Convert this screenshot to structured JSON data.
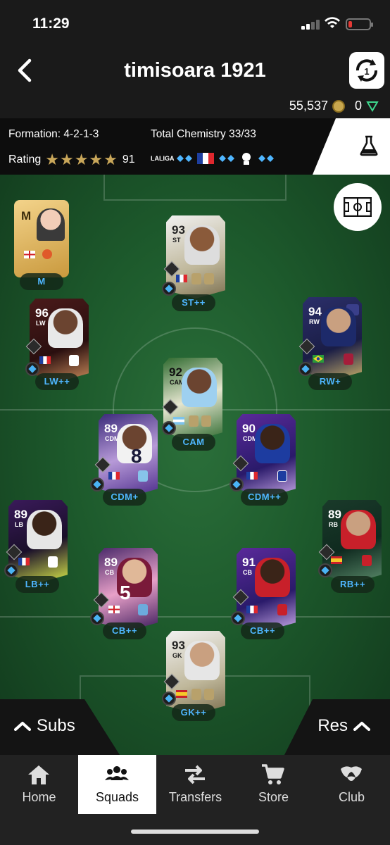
{
  "status": {
    "time": "11:29"
  },
  "header": {
    "title": "timisoara 1921",
    "coins": "55,537",
    "points": "0"
  },
  "info": {
    "formation_label": "Formation: 4-2-1-3",
    "chemistry_label": "Total Chemistry 33/33",
    "rating_label": "Rating",
    "stars": "★★★★★",
    "rating_value": "91",
    "league_text": "LALIGA"
  },
  "colors": {
    "accent_blue": "#4fb6ff",
    "pitch": "#1d5a2c",
    "stars": "#c9a75a"
  },
  "players": [
    {
      "id": "manager",
      "rating": "M",
      "position": "",
      "label": "M"
    },
    {
      "id": "st",
      "rating": "93",
      "position": "ST",
      "label": "ST++"
    },
    {
      "id": "lw",
      "rating": "96",
      "position": "LW",
      "label": "LW++"
    },
    {
      "id": "rw",
      "rating": "94",
      "position": "RW",
      "label": "RW+"
    },
    {
      "id": "cam",
      "rating": "92",
      "position": "CAM",
      "label": "CAM"
    },
    {
      "id": "cdm1",
      "rating": "89",
      "position": "CDM",
      "label": "CDM+",
      "number": "8"
    },
    {
      "id": "cdm2",
      "rating": "90",
      "position": "CDM",
      "label": "CDM++"
    },
    {
      "id": "lb",
      "rating": "89",
      "position": "LB",
      "label": "LB++"
    },
    {
      "id": "rb",
      "rating": "89",
      "position": "RB",
      "label": "RB++"
    },
    {
      "id": "cb1",
      "rating": "89",
      "position": "CB",
      "label": "CB++",
      "number": "5"
    },
    {
      "id": "cb2",
      "rating": "91",
      "position": "CB",
      "label": "CB++"
    },
    {
      "id": "gk",
      "rating": "93",
      "position": "GK",
      "label": "GK++"
    }
  ],
  "bench": {
    "subs": "Subs",
    "res": "Res"
  },
  "tabs": [
    {
      "label": "Home",
      "icon": "home-icon"
    },
    {
      "label": "Squads",
      "icon": "squads-icon",
      "active": true
    },
    {
      "label": "Transfers",
      "icon": "transfers-icon"
    },
    {
      "label": "Store",
      "icon": "store-icon"
    },
    {
      "label": "Club",
      "icon": "club-icon"
    }
  ]
}
